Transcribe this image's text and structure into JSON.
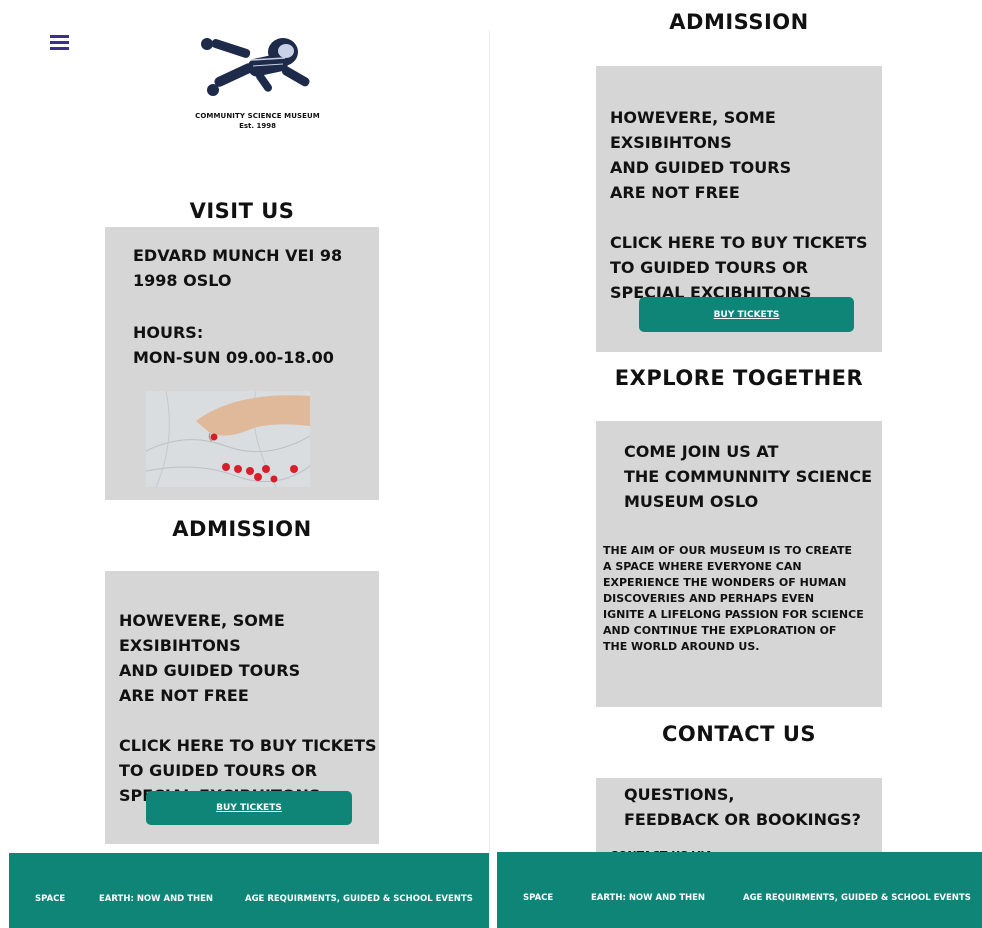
{
  "logo": {
    "name": "Community Science Museum",
    "est": "Est. 1998"
  },
  "menu": {
    "icon": "hamburger-menu-icon"
  },
  "visit": {
    "title": "Visit Us",
    "address": "EDVARD MUNCH VEI 98\n1998 OSLO",
    "hours": "Hours:\nMON-SUN 09.00-18.00"
  },
  "admission": {
    "title": "Admission",
    "text": "HOWEVERE, SOME EXSIBIHTONS\nAND GUIDED TOURS\nARE NOT FREE\n\nCLICK HERE TO BUY TICKETS\nTO GUIDED TOURS OR\nSPECIAL EXCIBHITONS",
    "button": "Buy Tickets"
  },
  "explore": {
    "title": "Explore Together",
    "heading": "COME JOIN US AT\nTHE COMMUNNITY SCIENCE\nMUSEUM OSLO",
    "body": "THE AIM OF OUR MUSEUM IS TO CREATE\nA SPACE WHERE EVERYONE CAN\nEXPERIENCE THE WONDERS OF HUMAN\nDISCOVERIES AND PERHAPS EVEN\nIGNITE A LIFELONG PASSION FOR SCIENCE\nAND CONTINUE THE EXPLORATION OF\nTHE WORLD AROUND US."
  },
  "contact": {
    "title": "Contact Us",
    "heading": "QUESTIONS,\nFEEDBACK OR BOOKINGS?",
    "partial": "CONTACT US VIA"
  },
  "footer": {
    "links": [
      "Space",
      "Earth: Now and Then",
      "Age Requirments, Guided & School Events"
    ]
  },
  "colors": {
    "accent": "#0e8577",
    "box": "#d6d6d6",
    "menu": "#3b2f8f"
  }
}
